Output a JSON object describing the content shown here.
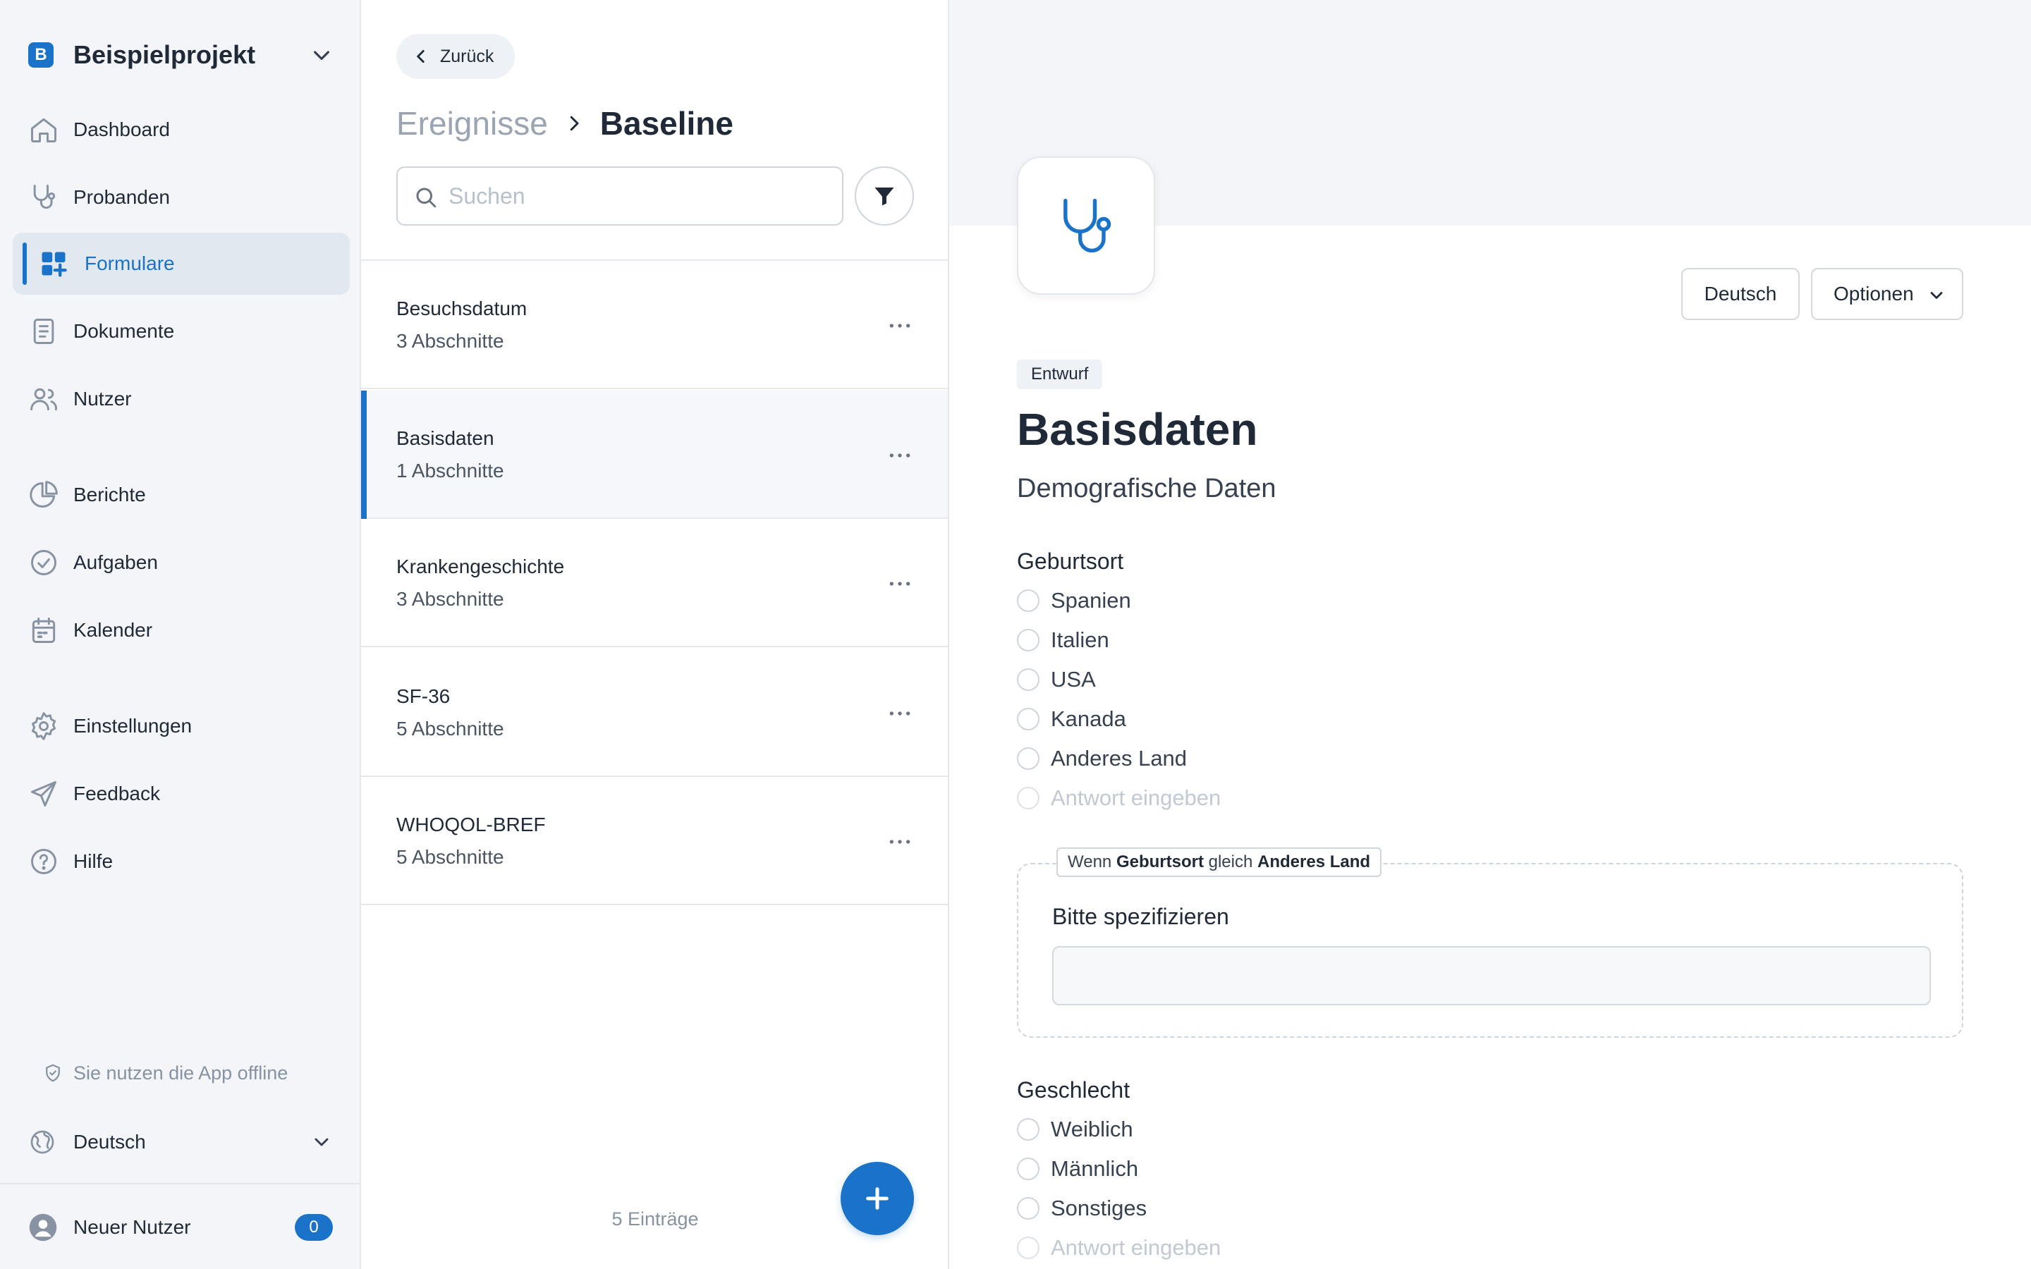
{
  "project": {
    "logo_letter": "B",
    "name": "Beispielprojekt"
  },
  "sidebar": {
    "items": [
      {
        "label": "Dashboard",
        "icon": "home-icon"
      },
      {
        "label": "Probanden",
        "icon": "stethoscope-icon"
      },
      {
        "label": "Formulare",
        "icon": "forms-icon",
        "active": true
      },
      {
        "label": "Dokumente",
        "icon": "document-icon"
      },
      {
        "label": "Nutzer",
        "icon": "users-icon"
      },
      {
        "label": "Berichte",
        "icon": "pie-chart-icon"
      },
      {
        "label": "Aufgaben",
        "icon": "check-circle-icon"
      },
      {
        "label": "Kalender",
        "icon": "calendar-icon"
      },
      {
        "label": "Einstellungen",
        "icon": "gear-icon"
      },
      {
        "label": "Feedback",
        "icon": "send-icon"
      },
      {
        "label": "Hilfe",
        "icon": "help-icon"
      }
    ],
    "offline_text": "Sie nutzen die App offline",
    "language": "Deutsch",
    "user_name": "Neuer Nutzer",
    "user_badge": "0"
  },
  "list": {
    "back_label": "Zurück",
    "breadcrumb_parent": "Ereignisse",
    "breadcrumb_current": "Baseline",
    "search_placeholder": "Suchen",
    "items": [
      {
        "title": "Besuchsdatum",
        "subtitle": "3 Abschnitte"
      },
      {
        "title": "Basisdaten",
        "subtitle": "1 Abschnitte",
        "active": true
      },
      {
        "title": "Krankengeschichte",
        "subtitle": "3 Abschnitte"
      },
      {
        "title": "SF-36",
        "subtitle": "5 Abschnitte"
      },
      {
        "title": "WHOQOL-BREF",
        "subtitle": "5 Abschnitte"
      }
    ],
    "count_label": "5 Einträge"
  },
  "form": {
    "language_button": "Deutsch",
    "options_button": "Optionen",
    "status": "Entwurf",
    "title": "Basisdaten",
    "subtitle": "Demografische Daten",
    "q1": {
      "label": "Geburtsort",
      "options": [
        "Spanien",
        "Italien",
        "USA",
        "Kanada",
        "Anderes Land"
      ],
      "placeholder": "Antwort eingeben"
    },
    "condition": {
      "prefix": "Wenn ",
      "field": "Geburtsort",
      "operator": " gleich ",
      "value": "Anderes Land",
      "question": "Bitte spezifizieren",
      "input_value": ""
    },
    "q2": {
      "label": "Geschlecht",
      "options": [
        "Weiblich",
        "Männlich",
        "Sonstiges"
      ],
      "placeholder": "Antwort eingeben"
    }
  },
  "colors": {
    "accent": "#1a73c9",
    "sidebar_bg": "#f3f5f8",
    "text": "#1f2937"
  }
}
